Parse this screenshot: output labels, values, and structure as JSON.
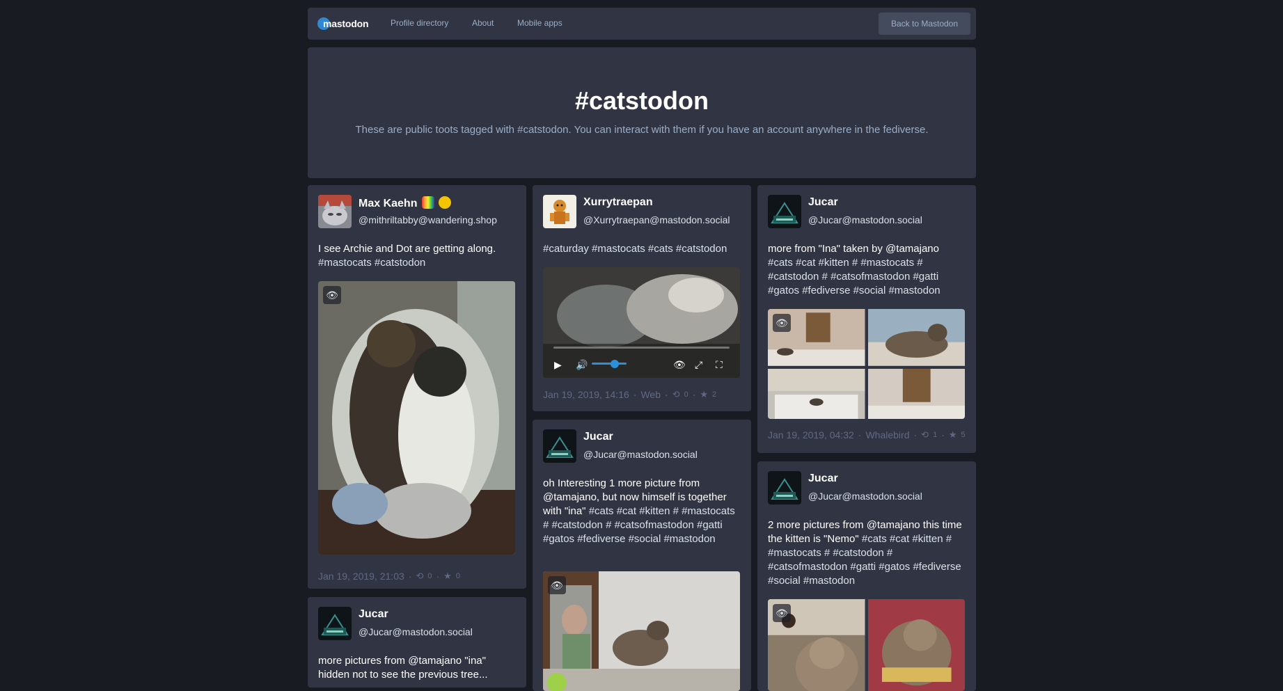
{
  "nav": {
    "logo": "mastodon",
    "links": [
      "Profile directory",
      "About",
      "Mobile apps"
    ],
    "back_button": "Back to Mastodon"
  },
  "hero": {
    "title": "#catstodon",
    "description": "These are public toots tagged with #catstodon. You can interact with them if you have an account anywhere in the fediverse."
  },
  "colors": {
    "background": "#191b22",
    "card": "#313543",
    "accent": "#2b90d9",
    "muted": "#606984",
    "secondary_text": "#9baec8"
  },
  "posts": [
    {
      "display_name": "Max Kaehn",
      "account": "@mithriltabby@wandering.shop",
      "content_text": "I see Archie and Dot are getting along. ",
      "content_tags": "#mastocats #catstodon",
      "timestamp": "Jan 19, 2019, 21:03",
      "boosts": "0",
      "favourites": "0"
    },
    {
      "display_name": "Jucar",
      "account": "@Jucar@mastodon.social",
      "content_text": "more pictures from @tamajano \"ina\" hidden not to see the previous tree..."
    },
    {
      "display_name": "Xurrytraepan",
      "account": "@Xurrytraepan@mastodon.social",
      "content_tags": "#caturday #mastocats #cats #catstodon",
      "timestamp": "Jan 19, 2019, 14:16",
      "app": "Web",
      "boosts": "0",
      "favourites": "2"
    },
    {
      "display_name": "Jucar",
      "account": "@Jucar@mastodon.social",
      "content_text": "oh Interesting 1 more picture from @tamajano, but now himself is together with \"ina\" ",
      "content_tags": "#cats #cat #kitten # #mastocats # #catstodon # #catsofmastodon #gatti #gatos #fediverse #social #mastodon"
    },
    {
      "display_name": "Jucar",
      "account": "@Jucar@mastodon.social",
      "content_text": "more from \"Ina\" taken by @tamajano ",
      "content_tags": "#cats #cat #kitten # #mastocats # #catstodon # #catsofmastodon #gatti #gatos #fediverse #social #mastodon",
      "timestamp": "Jan 19, 2019, 04:32",
      "app": "Whalebird",
      "boosts": "1",
      "favourites": "5"
    },
    {
      "display_name": "Jucar",
      "account": "@Jucar@mastodon.social",
      "content_text": "2 more pictures from @tamajano this time the kitten is \"Nemo\" ",
      "content_tags": "#cats #cat #kitten # #mastocats # #catstodon # #catsofmastodon #gatti #gatos #fediverse #social #mastodon"
    }
  ],
  "icons": {
    "eye": "eye-icon",
    "boost": "retweet-icon",
    "favourite": "star-icon",
    "play": "play-icon",
    "volume": "volume-icon",
    "expand": "expand-icon",
    "fullscreen": "fullscreen-icon"
  }
}
